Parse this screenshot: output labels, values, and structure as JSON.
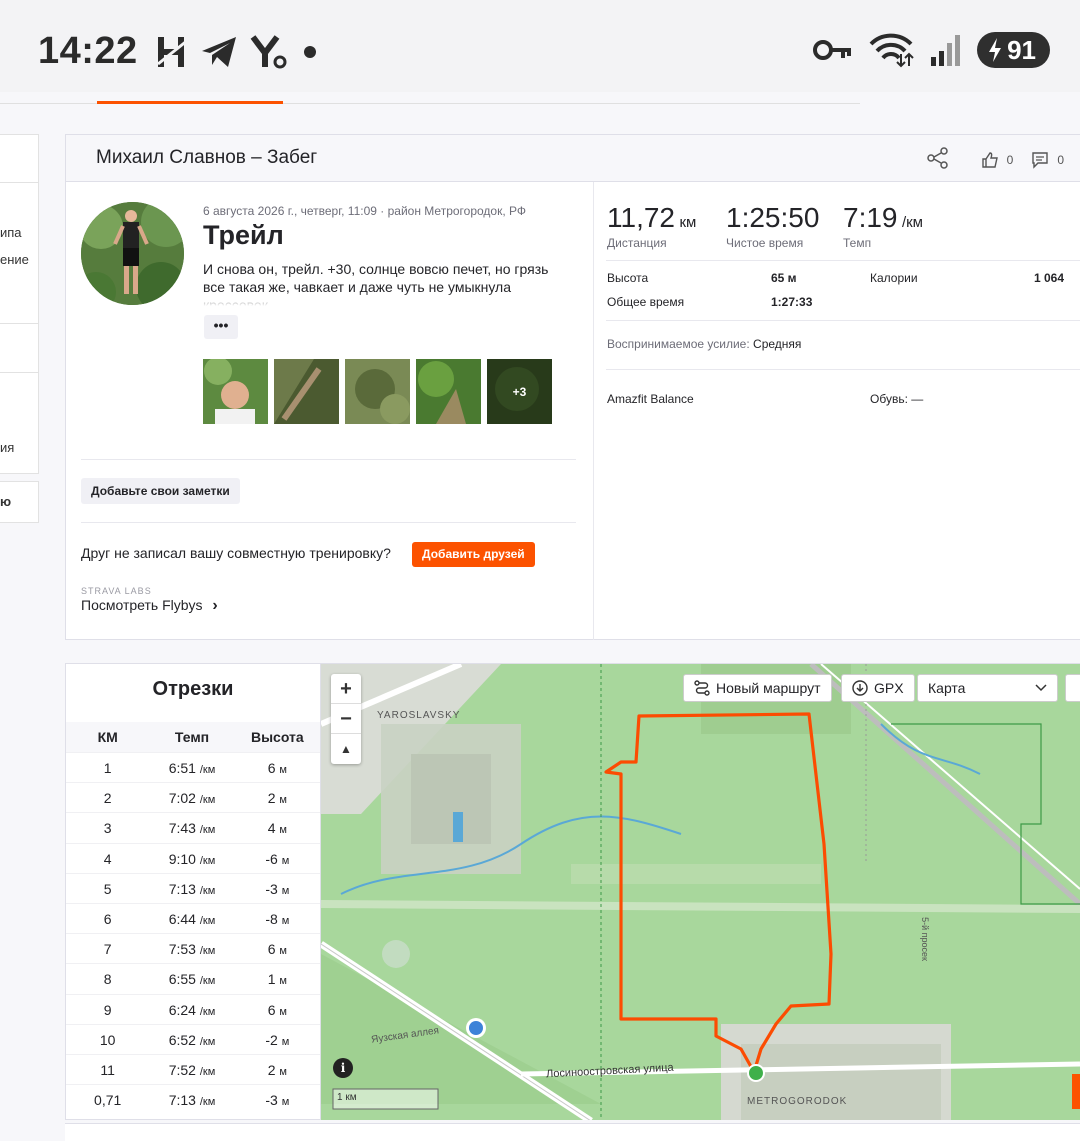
{
  "status_bar": {
    "time": "14:22",
    "battery": "91"
  },
  "activity": {
    "header_title": "Михаил Славнов – Забег",
    "likes": "0",
    "comments": "0",
    "date": "6 августа 2026 г., четверг, 11:09 · район Метрогородок, РФ",
    "name": "Трейл",
    "description": "И снова он, трейл. +30, солнце вовсю печет, но грязь все такая же, чавкает и даже чуть не умыкнула кроссовок.",
    "more_label": "•••",
    "photos_more": "+3",
    "notes_button": "Добавьте свои заметки",
    "friend_prompt": "Друг не записал вашу совместную тренировку?",
    "friend_button": "Добавить друзей",
    "labs_label": "STRAVA LABS",
    "flyby_link": "Посмотреть Flybys",
    "flyby_chevron": "›"
  },
  "sidebar": {
    "items": [
      "ипа",
      "ение",
      "ия",
      "ю"
    ]
  },
  "stats": {
    "distance": {
      "value": "11,72",
      "unit": "км",
      "label": "Дистанция"
    },
    "moving_time": {
      "value": "1:25:50",
      "label": "Чистое время"
    },
    "pace": {
      "value": "7:19",
      "unit": "/км",
      "label": "Темп"
    },
    "elevation_label": "Высота",
    "elevation_value": "65 м",
    "calories_label": "Калории",
    "calories_value": "1 064",
    "elapsed_label": "Общее время",
    "elapsed_value": "1:27:33",
    "effort_label": "Воспринимаемое усилие:",
    "effort_value": "Средняя",
    "device": "Amazfit Balance",
    "shoes_label": "Обувь:",
    "shoes_value": "—"
  },
  "splits": {
    "title": "Отрезки",
    "headers": [
      "КМ",
      "Темп",
      "Высота"
    ],
    "pace_unit": "/км",
    "elev_unit": "м",
    "rows": [
      {
        "km": "1",
        "pace": "6:51",
        "elev": "6"
      },
      {
        "km": "2",
        "pace": "7:02",
        "elev": "2"
      },
      {
        "km": "3",
        "pace": "7:43",
        "elev": "4"
      },
      {
        "km": "4",
        "pace": "9:10",
        "elev": "-6"
      },
      {
        "km": "5",
        "pace": "7:13",
        "elev": "-3"
      },
      {
        "km": "6",
        "pace": "6:44",
        "elev": "-8"
      },
      {
        "km": "7",
        "pace": "7:53",
        "elev": "6"
      },
      {
        "km": "8",
        "pace": "6:55",
        "elev": "1"
      },
      {
        "km": "9",
        "pace": "6:24",
        "elev": "6"
      },
      {
        "km": "10",
        "pace": "6:52",
        "elev": "-2"
      },
      {
        "km": "11",
        "pace": "7:52",
        "elev": "2"
      },
      {
        "km": "0,71",
        "pace": "7:13",
        "elev": "-3"
      }
    ]
  },
  "map": {
    "new_route": "Новый маршрут",
    "gpx": "GPX",
    "map_type": "Карта",
    "label_yaroslavsky": "YAROSLAVSKY",
    "label_metrogorodok": "METROGORODOK",
    "label_street": "Лосиноостровская улица",
    "label_alley": "Яузская аллея",
    "label_prosek": "5-й просек",
    "scale": "1 км",
    "route_color": "#fc4c02"
  }
}
